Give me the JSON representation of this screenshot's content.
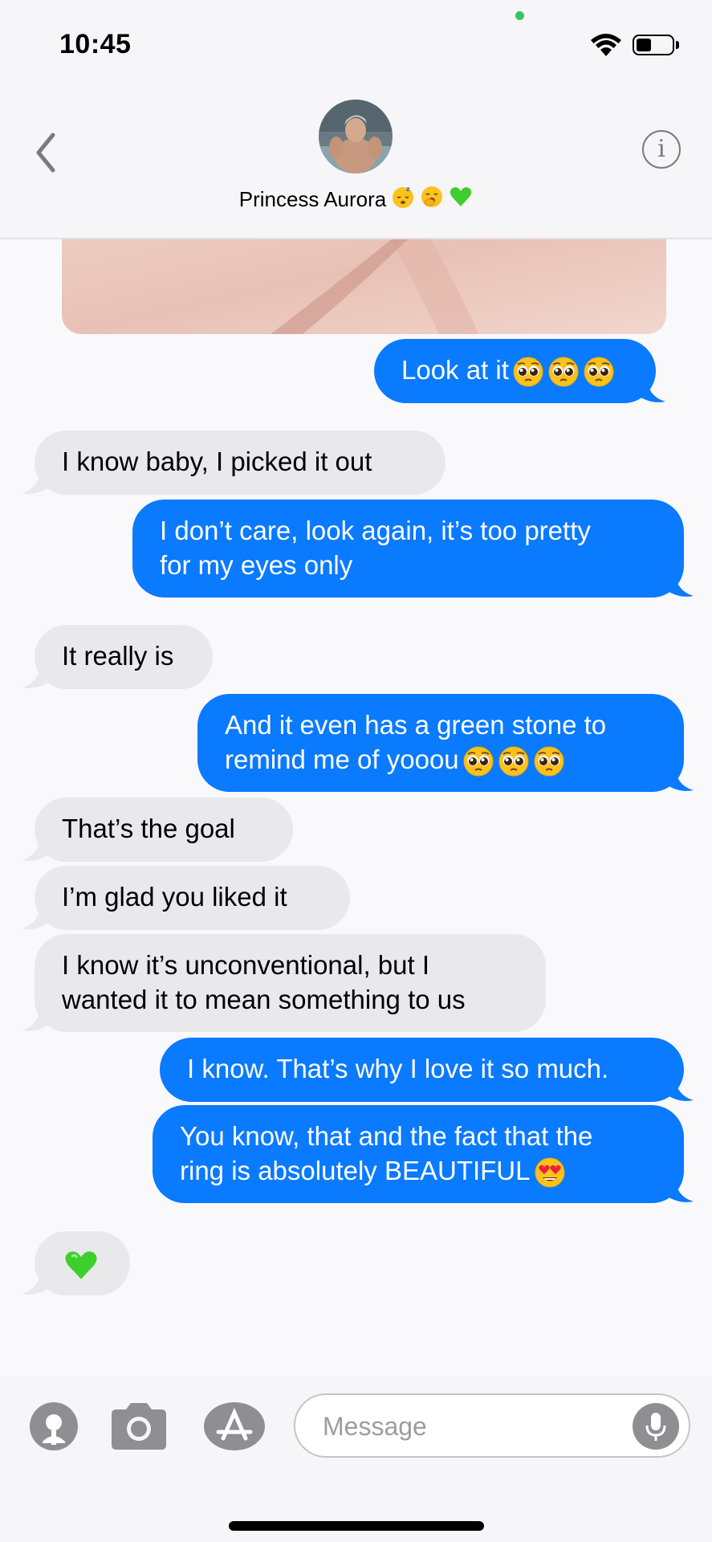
{
  "status_bar": {
    "time": "10:45",
    "battery_level": 0.45
  },
  "header": {
    "contact_name": "Princess Aurora",
    "name_emojis": [
      "sleeping-face-emoji",
      "yawning-face-emoji",
      "green-heart-emoji"
    ],
    "info_label": "i"
  },
  "messages": [
    {
      "side": "sent",
      "lines": [
        "Look at it"
      ],
      "emojis": [
        "pleading-face",
        "pleading-face",
        "pleading-face"
      ]
    },
    {
      "side": "recv",
      "lines": [
        "I know baby, I picked it out"
      ]
    },
    {
      "side": "sent",
      "lines": [
        "I don’t care, look again, it’s too pretty",
        "for my eyes only"
      ]
    },
    {
      "side": "recv",
      "lines": [
        "It really is"
      ]
    },
    {
      "side": "sent",
      "lines": [
        "And it even has a green stone to",
        "remind me of yooou"
      ],
      "emojis": [
        "pleading-face",
        "pleading-face",
        "pleading-face"
      ]
    },
    {
      "side": "recv",
      "lines": [
        "That’s the goal"
      ]
    },
    {
      "side": "recv",
      "lines": [
        "I’m glad you liked it"
      ]
    },
    {
      "side": "recv",
      "lines": [
        "I know it’s unconventional, but I",
        "wanted it to mean something to us"
      ]
    },
    {
      "side": "sent",
      "lines": [
        "I know. That’s why I love it so much."
      ]
    },
    {
      "side": "sent",
      "lines": [
        "You know, that and the fact that the",
        "ring is absolutely BEAUTIFUL"
      ],
      "emojis": [
        "heart-eyes-face"
      ]
    },
    {
      "side": "recv",
      "lines": [],
      "emojis": [
        "green-heart"
      ]
    }
  ],
  "input": {
    "placeholder": "Message"
  },
  "colors": {
    "sent_bubble": "#0a7aff",
    "recv_bubble": "#e9e9eb",
    "background": "#f9f9fb"
  }
}
